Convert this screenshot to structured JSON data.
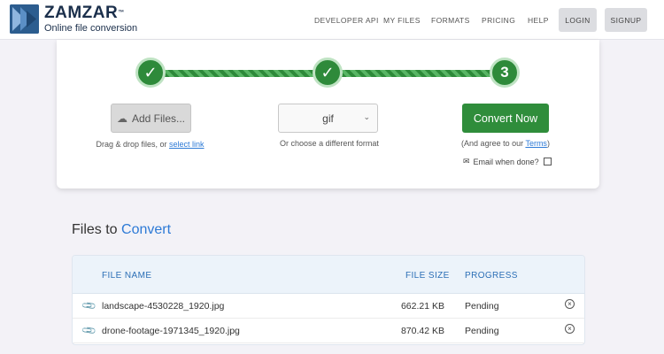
{
  "header": {
    "logo_name": "ZAMZAR",
    "logo_tm": "™",
    "logo_tagline": "Online file conversion",
    "nav": [
      "DEVELOPER API",
      "MY FILES",
      "FORMATS",
      "PRICING",
      "HELP"
    ],
    "login": "LOGIN",
    "signup": "SIGNUP"
  },
  "converter": {
    "steps": [
      "✓",
      "✓",
      "3"
    ],
    "add_files": "Add Files...",
    "drag_text": "Drag & drop files, or ",
    "select_link": "select link",
    "format": "gif",
    "format_hint": "Or choose a different format",
    "convert_button": "Convert Now",
    "agree_prefix": "(And agree to our ",
    "terms_link": "Terms",
    "agree_suffix": ")",
    "email_label": "Email when done?"
  },
  "files": {
    "title_prefix": "Files to ",
    "title_accent": "Convert",
    "columns": [
      "FILE NAME",
      "FILE SIZE",
      "PROGRESS"
    ],
    "rows": [
      {
        "name": "landscape-4530228_1920.jpg",
        "size": "662.21 KB",
        "status": "Pending"
      },
      {
        "name": "drone-footage-1971345_1920.jpg",
        "size": "870.42 KB",
        "status": "Pending"
      }
    ]
  },
  "colors": {
    "brand_green": "#2f8d3b",
    "link_blue": "#2d7ad6",
    "brand_navy": "#1b2f4b"
  }
}
